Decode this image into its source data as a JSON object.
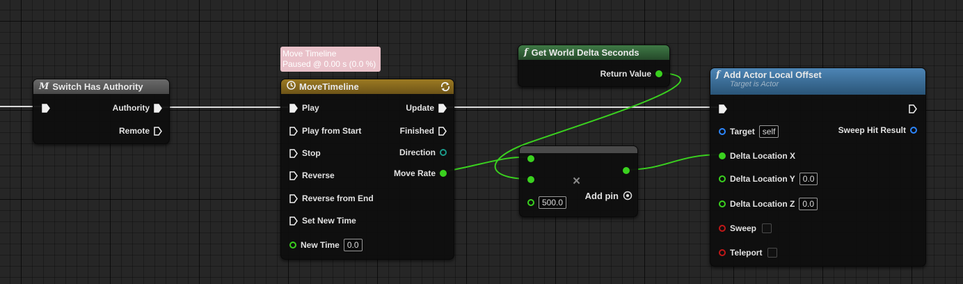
{
  "colors": {
    "graph_bg": "#262626",
    "exec_wire": "#dcdcdc",
    "float_wire": "#3ad11f",
    "macro_header": "#5c5c5c",
    "timeline_header": "#8a6a1a",
    "pure_function_header": "#2f5d35",
    "function_header": "#3d6d95",
    "tooltip_bg": "#e9c1c9"
  },
  "switch_has_authority": {
    "icon": "macro-icon",
    "icon_glyph": "M",
    "title": "Switch Has Authority",
    "outputs": [
      "Authority",
      "Remote"
    ]
  },
  "move_timeline": {
    "tooltip_line1": "Move Timeline",
    "tooltip_line2": "Paused @ 0.00 s (0.0 %)",
    "icon": "clock-icon",
    "title": "MoveTimeline",
    "loop_icon": "loop-icon",
    "inputs": [
      "Play",
      "Play from Start",
      "Stop",
      "Reverse",
      "Reverse from End",
      "Set New Time"
    ],
    "new_time_label": "New Time",
    "new_time_value": "0.0",
    "outputs": [
      "Update",
      "Finished",
      "Direction",
      "Move Rate"
    ]
  },
  "get_world_delta_seconds": {
    "icon": "function-icon",
    "icon_glyph": "f",
    "title": "Get World Delta Seconds",
    "output": "Return Value"
  },
  "multiply": {
    "icon": "multiply-icon",
    "symbol": "×",
    "third_input_value": "500.0",
    "add_pin_label": "Add pin",
    "add_pin_icon": "add-circle-icon"
  },
  "add_actor_local_offset": {
    "icon": "function-icon",
    "icon_glyph": "f",
    "title": "Add Actor Local Offset",
    "subtitle": "Target is Actor",
    "target_label": "Target",
    "target_value": "self",
    "sweep_hit_result": "Sweep Hit Result",
    "delta_x_label": "Delta Location X",
    "delta_y_label": "Delta Location Y",
    "delta_y_value": "0.0",
    "delta_z_label": "Delta Location Z",
    "delta_z_value": "0.0",
    "sweep_label": "Sweep",
    "teleport_label": "Teleport"
  }
}
